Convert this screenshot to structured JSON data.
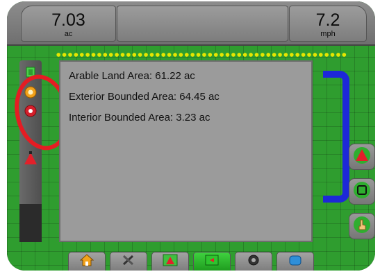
{
  "readouts": {
    "left": {
      "value": "7.03",
      "unit": "ac"
    },
    "right": {
      "value": "7.2",
      "unit": "mph"
    }
  },
  "area_panel": {
    "lines": [
      "Arable Land Area: 61.22 ac",
      "Exterior Bounded Area: 64.45 ac",
      "Interior Bounded Area: 3.23 ac"
    ]
  },
  "icons": {
    "left_bar": [
      "field-bounds-icon",
      "marker-a-icon",
      "hazard-point-icon",
      "vehicle-icon"
    ],
    "right_bar": [
      "guidance-arrow-icon",
      "map-view-icon",
      "touch-select-icon"
    ],
    "bottom_tabs": [
      "home-icon",
      "tools-icon",
      "vehicle-view-icon",
      "field-view-icon",
      "camera-icon",
      "tank-icon"
    ]
  },
  "colors": {
    "field_green": "#2f9d2f",
    "boundary_blue": "#1d28d8",
    "highlight_red": "#e51c23",
    "active_tab": "#2ec42e"
  }
}
